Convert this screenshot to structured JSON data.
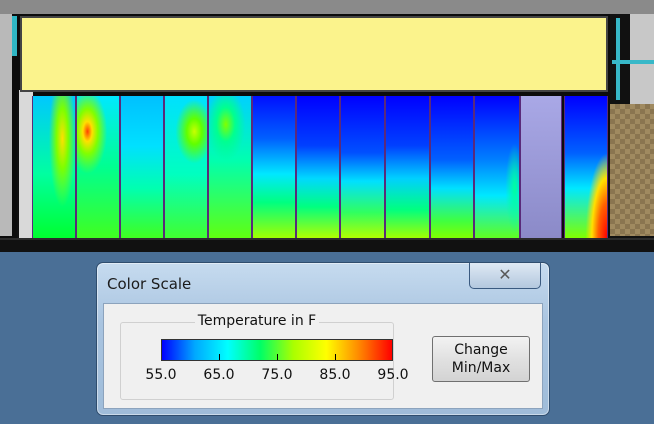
{
  "dialog": {
    "title": "Color Scale",
    "close_glyph": "✕",
    "group_title": "Temperature in F",
    "scale_labels": [
      "55.0",
      "65.0",
      "75.0",
      "85.0",
      "95.0"
    ],
    "change_button_line1": "Change",
    "change_button_line2": "Min/Max"
  },
  "scale": {
    "min": 55.0,
    "max": 95.0,
    "ticks": [
      55.0,
      65.0,
      75.0,
      85.0,
      95.0
    ],
    "colors": [
      "#0000ff",
      "#00a8ff",
      "#00ffff",
      "#00ff66",
      "#aaff00",
      "#ffff00",
      "#ff8800",
      "#ff0000"
    ]
  },
  "visualization": {
    "panels": [
      {
        "id": "panel-1",
        "fill": "radial-gradient(ellipse 40% 60% at 70% 30%, #ffe000 0%, #7dff00 35%, transparent 80%), linear-gradient(#00c8ff 0%, #00ffa0 55%, #00ff30 100%)"
      },
      {
        "id": "panel-2",
        "fill": "radial-gradient(ellipse 55% 35% at 25% 25%, #ff4000 0%, #ffe000 20%, #80ff00 45%, transparent 85%), linear-gradient(#00e8ff 0%, #00ff90 50%, #40ff20 100%)"
      },
      {
        "id": "panel-3",
        "fill": "linear-gradient(#00c0ff 0%, #00e0ff 35%, #00ffb0 65%, #40ff20 100%)"
      },
      {
        "id": "panel-4",
        "fill": "radial-gradient(ellipse 60% 30% at 70% 25%, #c8ff00 0%, #60ff00 30%, transparent 75%), linear-gradient(#00e0ff 0%, #00ffc0 55%, #40ff30 100%)"
      },
      {
        "id": "panel-5",
        "fill": "radial-gradient(ellipse 55% 30% at 40% 20%, #80ff00 0%, #00ff90 40%, transparent 85%), linear-gradient(#00d0ff 0%, #00ffb0 45%, #60ff10 100%)"
      },
      {
        "id": "panel-6",
        "fill": "linear-gradient(#0010ff 0%, #0060ff 30%, #00e8ff 55%, #00ff80 75%, #a0ff00 100%)"
      },
      {
        "id": "panel-7",
        "fill": "linear-gradient(#0000ff 0%, #0040ff 35%, #00d8ff 58%, #00ff80 78%, #b0ff00 100%)"
      },
      {
        "id": "panel-8",
        "fill": "linear-gradient(#0000ff 0%, #0050ff 40%, #00e0ff 60%, #30ff60 82%, #b0ff00 100%)"
      },
      {
        "id": "panel-9",
        "fill": "linear-gradient(#0000ff 0%, #0040ff 35%, #00d0ff 58%, #00ff80 80%, #a0ff00 100%)"
      },
      {
        "id": "panel-10",
        "fill": "linear-gradient(#0000ff 0%, #0060ff 45%, #00e0ff 65%, #40ff40 88%, #80ff00 100%)"
      },
      {
        "id": "panel-11",
        "fill": "radial-gradient(ellipse 30% 45% at 90% 65%, #00ffa0 0%, transparent 70%), linear-gradient(#0000ff 0%, #0080ff 45%, #00e8ff 70%, #60ff20 100%)"
      },
      {
        "id": "panel-gray",
        "fill": "linear-gradient(#a9a8e6, #8b8ac8)"
      },
      {
        "id": "panel-hot",
        "fill": "radial-gradient(ellipse 60% 70% at 100% 100%, #ff0000 0%, #ff6000 35%, #ffe000 60%, transparent 85%), linear-gradient(#0000ff 0%, #0060ff 40%, #00e8ff 65%, #80ff00 100%)"
      }
    ]
  }
}
